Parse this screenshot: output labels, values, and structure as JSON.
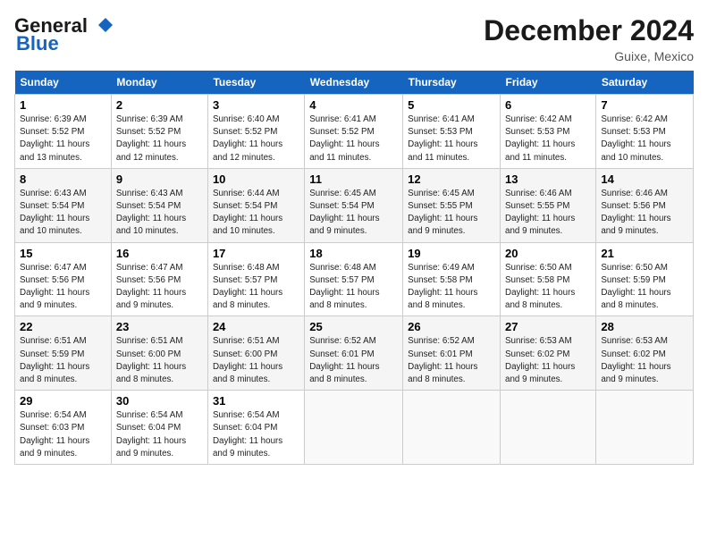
{
  "header": {
    "logo_line1": "General",
    "logo_line2": "Blue",
    "month": "December 2024",
    "location": "Guixe, Mexico"
  },
  "weekdays": [
    "Sunday",
    "Monday",
    "Tuesday",
    "Wednesday",
    "Thursday",
    "Friday",
    "Saturday"
  ],
  "weeks": [
    [
      {
        "day": "1",
        "info": "Sunrise: 6:39 AM\nSunset: 5:52 PM\nDaylight: 11 hours\nand 13 minutes."
      },
      {
        "day": "2",
        "info": "Sunrise: 6:39 AM\nSunset: 5:52 PM\nDaylight: 11 hours\nand 12 minutes."
      },
      {
        "day": "3",
        "info": "Sunrise: 6:40 AM\nSunset: 5:52 PM\nDaylight: 11 hours\nand 12 minutes."
      },
      {
        "day": "4",
        "info": "Sunrise: 6:41 AM\nSunset: 5:52 PM\nDaylight: 11 hours\nand 11 minutes."
      },
      {
        "day": "5",
        "info": "Sunrise: 6:41 AM\nSunset: 5:53 PM\nDaylight: 11 hours\nand 11 minutes."
      },
      {
        "day": "6",
        "info": "Sunrise: 6:42 AM\nSunset: 5:53 PM\nDaylight: 11 hours\nand 11 minutes."
      },
      {
        "day": "7",
        "info": "Sunrise: 6:42 AM\nSunset: 5:53 PM\nDaylight: 11 hours\nand 10 minutes."
      }
    ],
    [
      {
        "day": "8",
        "info": "Sunrise: 6:43 AM\nSunset: 5:54 PM\nDaylight: 11 hours\nand 10 minutes."
      },
      {
        "day": "9",
        "info": "Sunrise: 6:43 AM\nSunset: 5:54 PM\nDaylight: 11 hours\nand 10 minutes."
      },
      {
        "day": "10",
        "info": "Sunrise: 6:44 AM\nSunset: 5:54 PM\nDaylight: 11 hours\nand 10 minutes."
      },
      {
        "day": "11",
        "info": "Sunrise: 6:45 AM\nSunset: 5:54 PM\nDaylight: 11 hours\nand 9 minutes."
      },
      {
        "day": "12",
        "info": "Sunrise: 6:45 AM\nSunset: 5:55 PM\nDaylight: 11 hours\nand 9 minutes."
      },
      {
        "day": "13",
        "info": "Sunrise: 6:46 AM\nSunset: 5:55 PM\nDaylight: 11 hours\nand 9 minutes."
      },
      {
        "day": "14",
        "info": "Sunrise: 6:46 AM\nSunset: 5:56 PM\nDaylight: 11 hours\nand 9 minutes."
      }
    ],
    [
      {
        "day": "15",
        "info": "Sunrise: 6:47 AM\nSunset: 5:56 PM\nDaylight: 11 hours\nand 9 minutes."
      },
      {
        "day": "16",
        "info": "Sunrise: 6:47 AM\nSunset: 5:56 PM\nDaylight: 11 hours\nand 9 minutes."
      },
      {
        "day": "17",
        "info": "Sunrise: 6:48 AM\nSunset: 5:57 PM\nDaylight: 11 hours\nand 8 minutes."
      },
      {
        "day": "18",
        "info": "Sunrise: 6:48 AM\nSunset: 5:57 PM\nDaylight: 11 hours\nand 8 minutes."
      },
      {
        "day": "19",
        "info": "Sunrise: 6:49 AM\nSunset: 5:58 PM\nDaylight: 11 hours\nand 8 minutes."
      },
      {
        "day": "20",
        "info": "Sunrise: 6:50 AM\nSunset: 5:58 PM\nDaylight: 11 hours\nand 8 minutes."
      },
      {
        "day": "21",
        "info": "Sunrise: 6:50 AM\nSunset: 5:59 PM\nDaylight: 11 hours\nand 8 minutes."
      }
    ],
    [
      {
        "day": "22",
        "info": "Sunrise: 6:51 AM\nSunset: 5:59 PM\nDaylight: 11 hours\nand 8 minutes."
      },
      {
        "day": "23",
        "info": "Sunrise: 6:51 AM\nSunset: 6:00 PM\nDaylight: 11 hours\nand 8 minutes."
      },
      {
        "day": "24",
        "info": "Sunrise: 6:51 AM\nSunset: 6:00 PM\nDaylight: 11 hours\nand 8 minutes."
      },
      {
        "day": "25",
        "info": "Sunrise: 6:52 AM\nSunset: 6:01 PM\nDaylight: 11 hours\nand 8 minutes."
      },
      {
        "day": "26",
        "info": "Sunrise: 6:52 AM\nSunset: 6:01 PM\nDaylight: 11 hours\nand 8 minutes."
      },
      {
        "day": "27",
        "info": "Sunrise: 6:53 AM\nSunset: 6:02 PM\nDaylight: 11 hours\nand 9 minutes."
      },
      {
        "day": "28",
        "info": "Sunrise: 6:53 AM\nSunset: 6:02 PM\nDaylight: 11 hours\nand 9 minutes."
      }
    ],
    [
      {
        "day": "29",
        "info": "Sunrise: 6:54 AM\nSunset: 6:03 PM\nDaylight: 11 hours\nand 9 minutes."
      },
      {
        "day": "30",
        "info": "Sunrise: 6:54 AM\nSunset: 6:04 PM\nDaylight: 11 hours\nand 9 minutes."
      },
      {
        "day": "31",
        "info": "Sunrise: 6:54 AM\nSunset: 6:04 PM\nDaylight: 11 hours\nand 9 minutes."
      },
      {
        "day": "",
        "info": ""
      },
      {
        "day": "",
        "info": ""
      },
      {
        "day": "",
        "info": ""
      },
      {
        "day": "",
        "info": ""
      }
    ]
  ]
}
